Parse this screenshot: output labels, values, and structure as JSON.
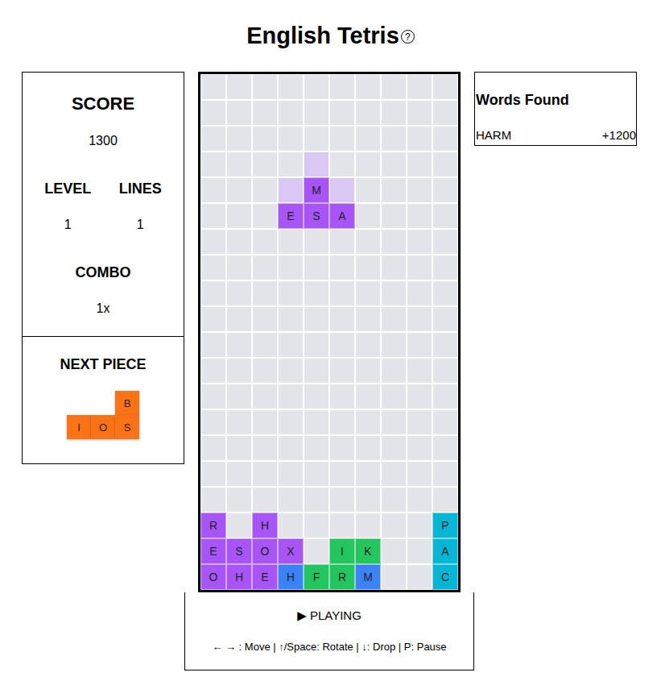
{
  "title": "English Tetris",
  "help_icon": "?",
  "score": {
    "label": "SCORE",
    "value": "1300"
  },
  "level": {
    "label": "LEVEL",
    "value": "1"
  },
  "lines": {
    "label": "LINES",
    "value": "1"
  },
  "combo": {
    "label": "COMBO",
    "value": "1x"
  },
  "next_piece": {
    "label": "NEXT PIECE",
    "color": "#f97316",
    "cells": [
      {
        "row": 0,
        "col": 2,
        "letter": "B"
      },
      {
        "row": 1,
        "col": 0,
        "letter": "I"
      },
      {
        "row": 1,
        "col": 1,
        "letter": "O"
      },
      {
        "row": 1,
        "col": 2,
        "letter": "S"
      }
    ]
  },
  "board": {
    "cells": [
      {
        "row": 3,
        "col": 4,
        "letter": "",
        "color": "#d9c8f3",
        "kind": "ghost"
      },
      {
        "row": 4,
        "col": 3,
        "letter": "",
        "color": "#d9c8f3",
        "kind": "ghost"
      },
      {
        "row": 4,
        "col": 4,
        "letter": "M",
        "color": "#a855f7",
        "kind": "block"
      },
      {
        "row": 4,
        "col": 5,
        "letter": "",
        "color": "#d9c8f3",
        "kind": "ghost"
      },
      {
        "row": 5,
        "col": 3,
        "letter": "E",
        "color": "#a855f7",
        "kind": "block"
      },
      {
        "row": 5,
        "col": 4,
        "letter": "S",
        "color": "#a855f7",
        "kind": "block"
      },
      {
        "row": 5,
        "col": 5,
        "letter": "A",
        "color": "#a855f7",
        "kind": "block"
      },
      {
        "row": 17,
        "col": 0,
        "letter": "R",
        "color": "#a855f7",
        "kind": "block"
      },
      {
        "row": 17,
        "col": 2,
        "letter": "H",
        "color": "#a855f7",
        "kind": "block"
      },
      {
        "row": 17,
        "col": 9,
        "letter": "P",
        "color": "#06b6d4",
        "kind": "block"
      },
      {
        "row": 18,
        "col": 0,
        "letter": "E",
        "color": "#a855f7",
        "kind": "block"
      },
      {
        "row": 18,
        "col": 1,
        "letter": "S",
        "color": "#a855f7",
        "kind": "block"
      },
      {
        "row": 18,
        "col": 2,
        "letter": "O",
        "color": "#a855f7",
        "kind": "block"
      },
      {
        "row": 18,
        "col": 3,
        "letter": "X",
        "color": "#a855f7",
        "kind": "block"
      },
      {
        "row": 18,
        "col": 5,
        "letter": "I",
        "color": "#22c55e",
        "kind": "block"
      },
      {
        "row": 18,
        "col": 6,
        "letter": "K",
        "color": "#22c55e",
        "kind": "block"
      },
      {
        "row": 18,
        "col": 9,
        "letter": "A",
        "color": "#06b6d4",
        "kind": "block"
      },
      {
        "row": 19,
        "col": 0,
        "letter": "O",
        "color": "#a855f7",
        "kind": "block"
      },
      {
        "row": 19,
        "col": 1,
        "letter": "H",
        "color": "#a855f7",
        "kind": "block"
      },
      {
        "row": 19,
        "col": 2,
        "letter": "E",
        "color": "#a855f7",
        "kind": "block"
      },
      {
        "row": 19,
        "col": 3,
        "letter": "H",
        "color": "#3b82f6",
        "kind": "block"
      },
      {
        "row": 19,
        "col": 4,
        "letter": "F",
        "color": "#22c55e",
        "kind": "block"
      },
      {
        "row": 19,
        "col": 5,
        "letter": "R",
        "color": "#22c55e",
        "kind": "block"
      },
      {
        "row": 19,
        "col": 6,
        "letter": "M",
        "color": "#3b82f6",
        "kind": "block"
      },
      {
        "row": 19,
        "col": 9,
        "letter": "C",
        "color": "#06b6d4",
        "kind": "block"
      }
    ]
  },
  "status": "▶ PLAYING",
  "controls_hint": "← → : Move | ↑/Space: Rotate | ↓: Drop | P: Pause",
  "words_found": {
    "title": "Words Found",
    "items": [
      {
        "word": "HARM",
        "points": "+1200"
      }
    ]
  }
}
